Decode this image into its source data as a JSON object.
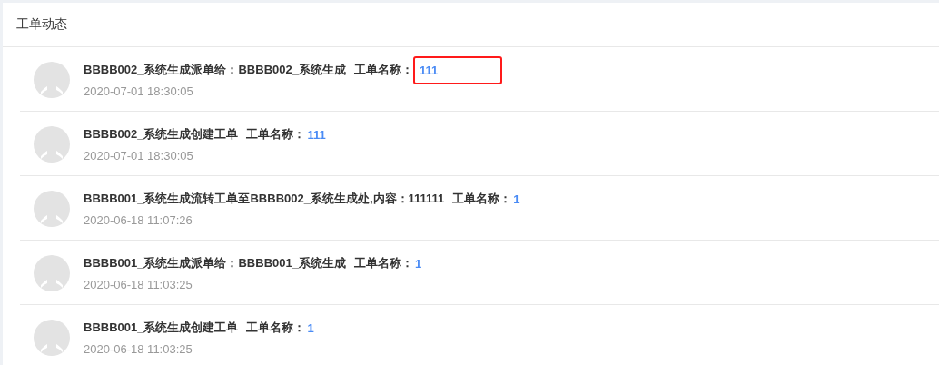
{
  "panel": {
    "title": "工单动态"
  },
  "activities": [
    {
      "text": "BBBB002_系统生成派单给：BBBB002_系统生成",
      "name_label": "工单名称：",
      "name": "111",
      "time": "2020-07-01 18:30:05",
      "highlighted": true
    },
    {
      "text": "BBBB002_系统生成创建工单",
      "name_label": "工单名称：",
      "name": "111",
      "time": "2020-07-01 18:30:05",
      "highlighted": false
    },
    {
      "text": "BBBB001_系统生成流转工单至BBBB002_系统生成处,内容：111111",
      "name_label": "工单名称：",
      "name": "1",
      "time": "2020-06-18 11:07:26",
      "highlighted": false
    },
    {
      "text": "BBBB001_系统生成派单给：BBBB001_系统生成",
      "name_label": "工单名称：",
      "name": "1",
      "time": "2020-06-18 11:03:25",
      "highlighted": false
    },
    {
      "text": "BBBB001_系统生成创建工单",
      "name_label": "工单名称：",
      "name": "1",
      "time": "2020-06-18 11:03:25",
      "highlighted": false
    }
  ]
}
